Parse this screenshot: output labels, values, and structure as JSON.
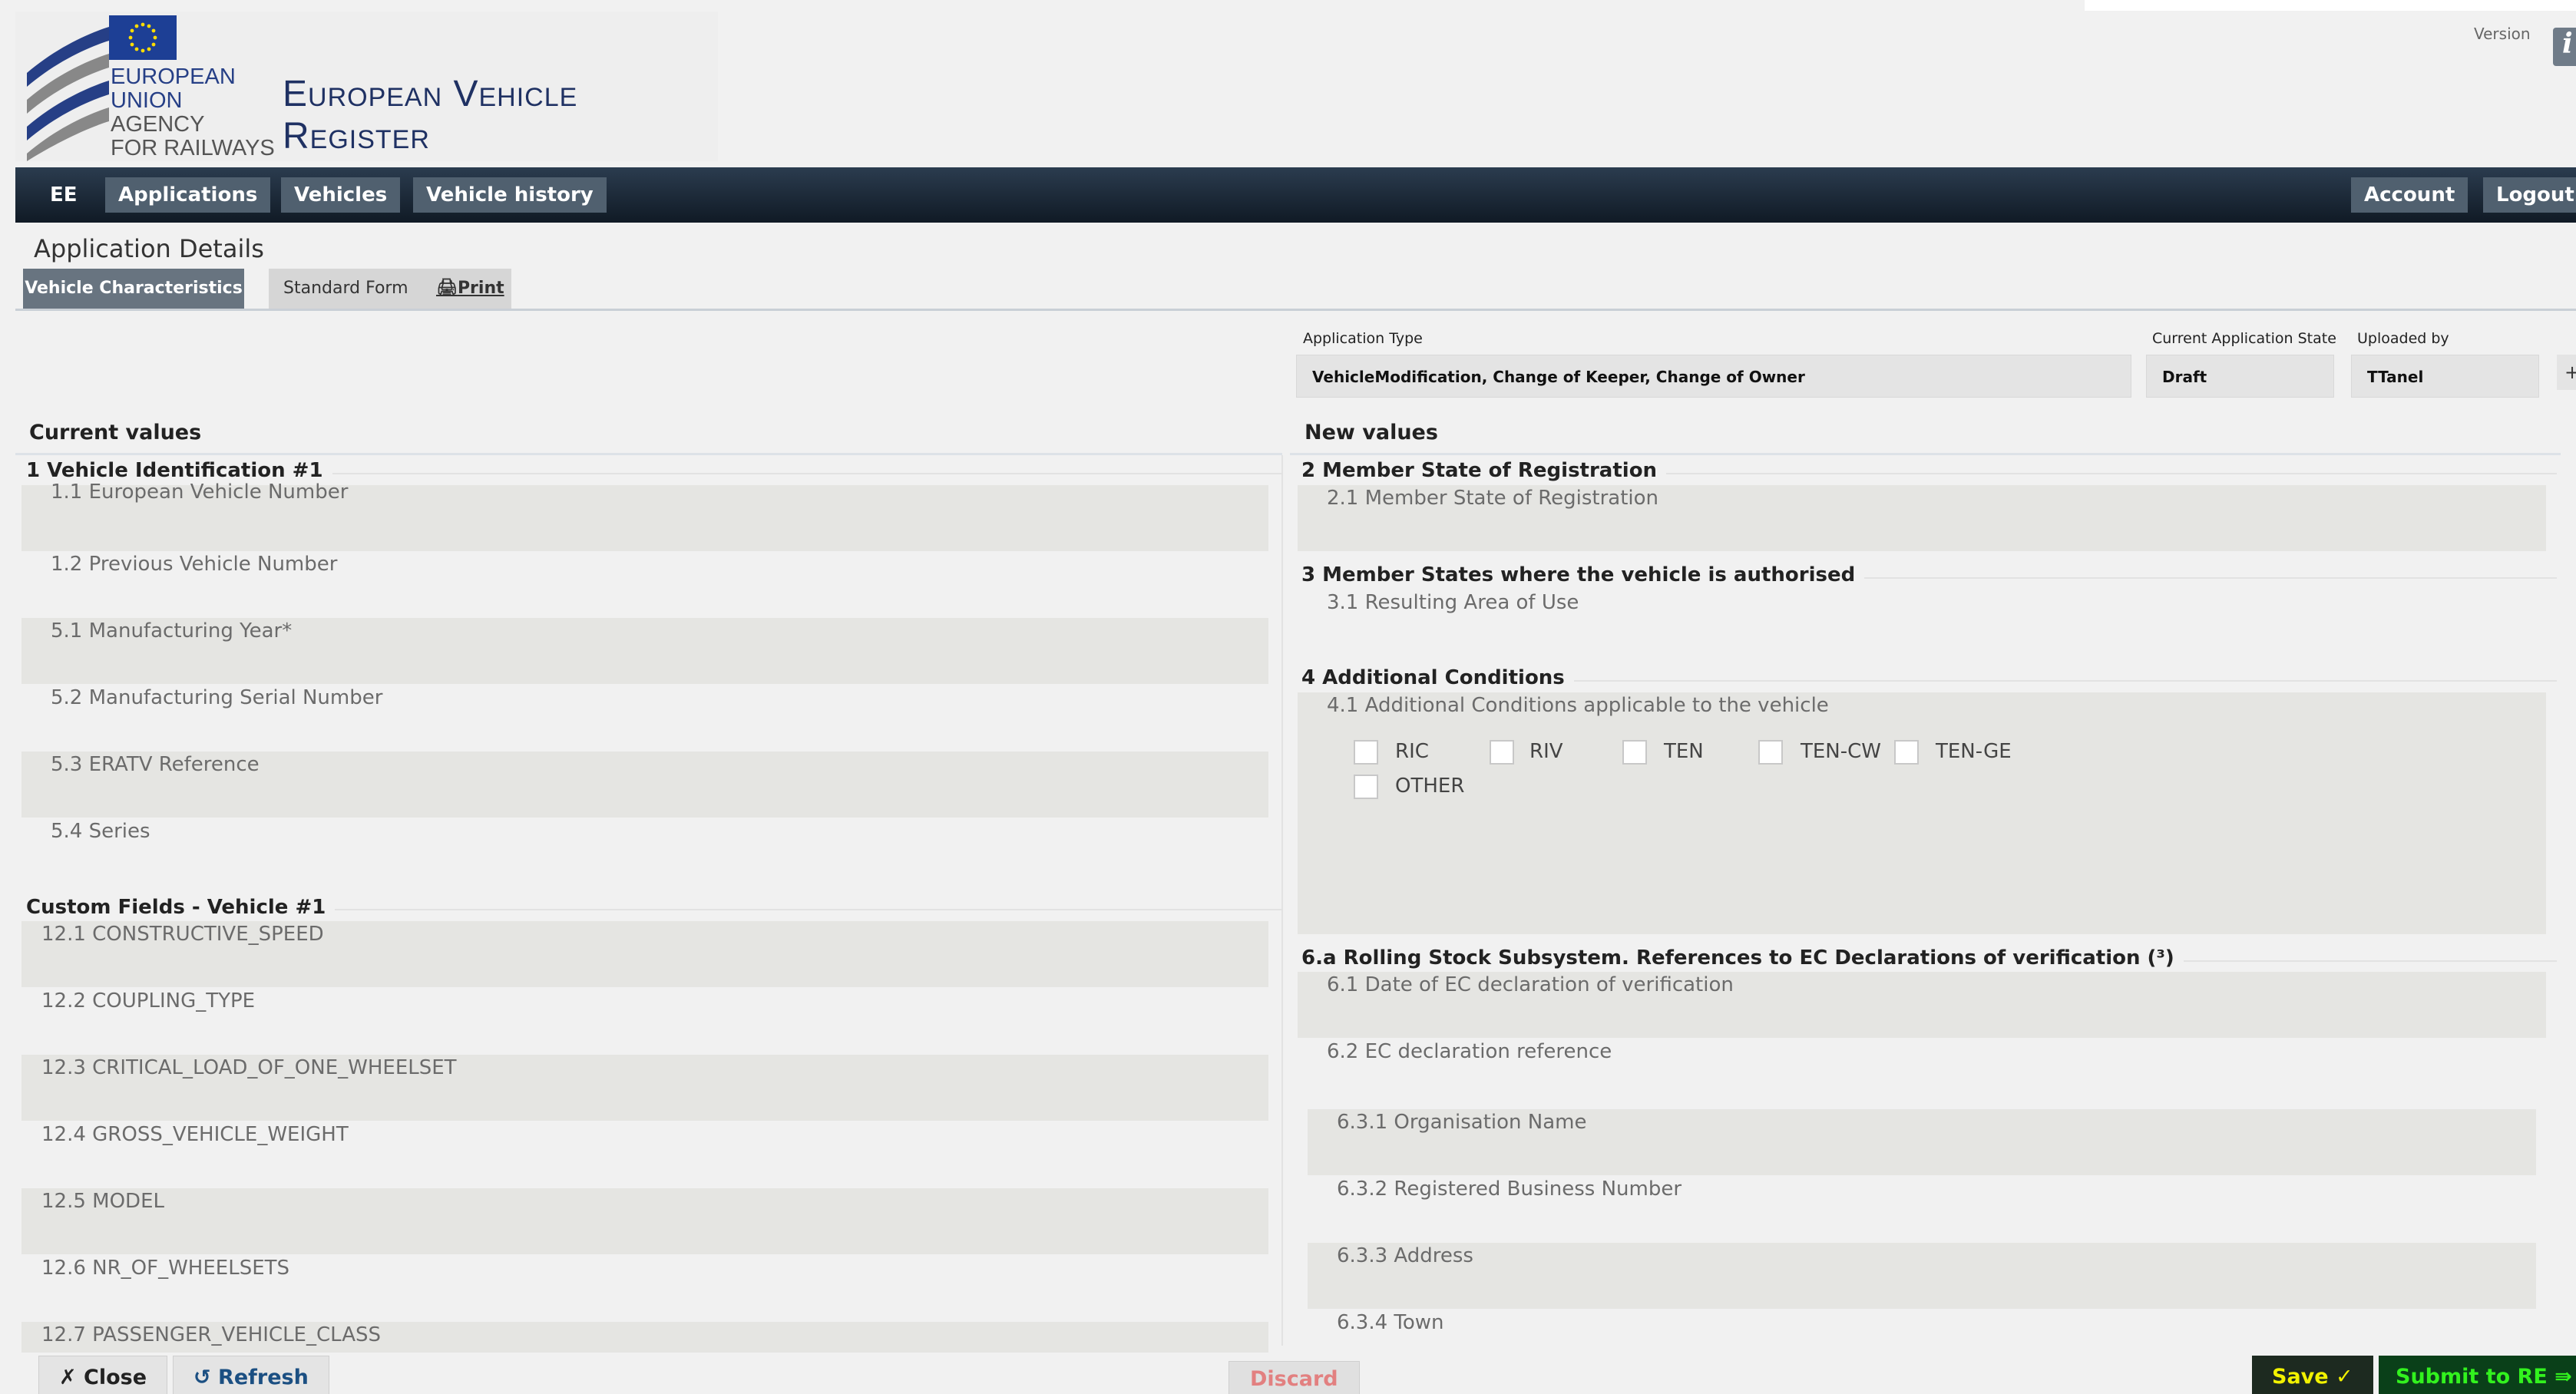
{
  "header": {
    "agency_lines": [
      "EUROPEAN",
      "UNION",
      "AGENCY",
      "FOR RAILWAYS"
    ],
    "title": "European Vehicle Register",
    "version_label": "Version",
    "info_icon": "i"
  },
  "nav": {
    "country": "EE",
    "items": [
      "Applications",
      "Vehicles",
      "Vehicle history"
    ],
    "account": "Account",
    "logout": "Logout"
  },
  "page": {
    "title": "Application Details",
    "tab_active": "Vehicle Characteristics",
    "tab_standard": "Standard Form",
    "print": "Print"
  },
  "application": {
    "type_label": "Application Type",
    "type_value": "VehicleModification, Change of Keeper, Change of Owner",
    "state_label": "Current Application State",
    "state_value": "Draft",
    "uploaded_label": "Uploaded by",
    "uploaded_value": "TTanel",
    "plus": "+"
  },
  "left": {
    "header": "Current values",
    "section1": "1 Vehicle Identification #1",
    "fields1": [
      "1.1 European Vehicle Number",
      "1.2 Previous Vehicle Number",
      "5.1 Manufacturing Year*",
      "5.2 Manufacturing Serial Number",
      "5.3 ERATV Reference",
      "5.4 Series"
    ],
    "section2": "Custom Fields - Vehicle #1",
    "fields2": [
      "12.1 CONSTRUCTIVE_SPEED",
      "12.2 COUPLING_TYPE",
      "12.3 CRITICAL_LOAD_OF_ONE_WHEELSET",
      "12.4 GROSS_VEHICLE_WEIGHT",
      "12.5 MODEL",
      "12.6 NR_OF_WHEELSETS",
      "12.7 PASSENGER_VEHICLE_CLASS"
    ]
  },
  "right": {
    "header": "New values",
    "section2": "2 Member State of Registration",
    "field2_1": "2.1 Member State of Registration",
    "section3": "3 Member States where the vehicle is authorised",
    "field3_1": "3.1 Resulting Area of Use",
    "section4": "4 Additional Conditions",
    "field4_1": "4.1 Additional Conditions applicable to the vehicle",
    "conditions": [
      "RIC",
      "RIV",
      "TEN",
      "TEN-CW",
      "TEN-GE",
      "OTHER"
    ],
    "section6a": "6.a Rolling Stock Subsystem. References to EC Declarations of verification (³)",
    "field6_1": "6.1 Date of EC declaration of verification",
    "field6_2": "6.2 EC declaration reference",
    "fields6_3": [
      "6.3.1 Organisation Name",
      "6.3.2 Registered Business Number",
      "6.3.3 Address",
      "6.3.4 Town"
    ]
  },
  "footer": {
    "close": "✗ Close",
    "refresh": "↺ Refresh",
    "discard": "Discard",
    "save": "Save ✓",
    "submit": "Submit to RE ⇛"
  },
  "colors": {
    "nav_bg": "#1a2634",
    "save_text": "#f2f200",
    "submit_text": "#32f21e",
    "discard_text": "#e28080"
  }
}
